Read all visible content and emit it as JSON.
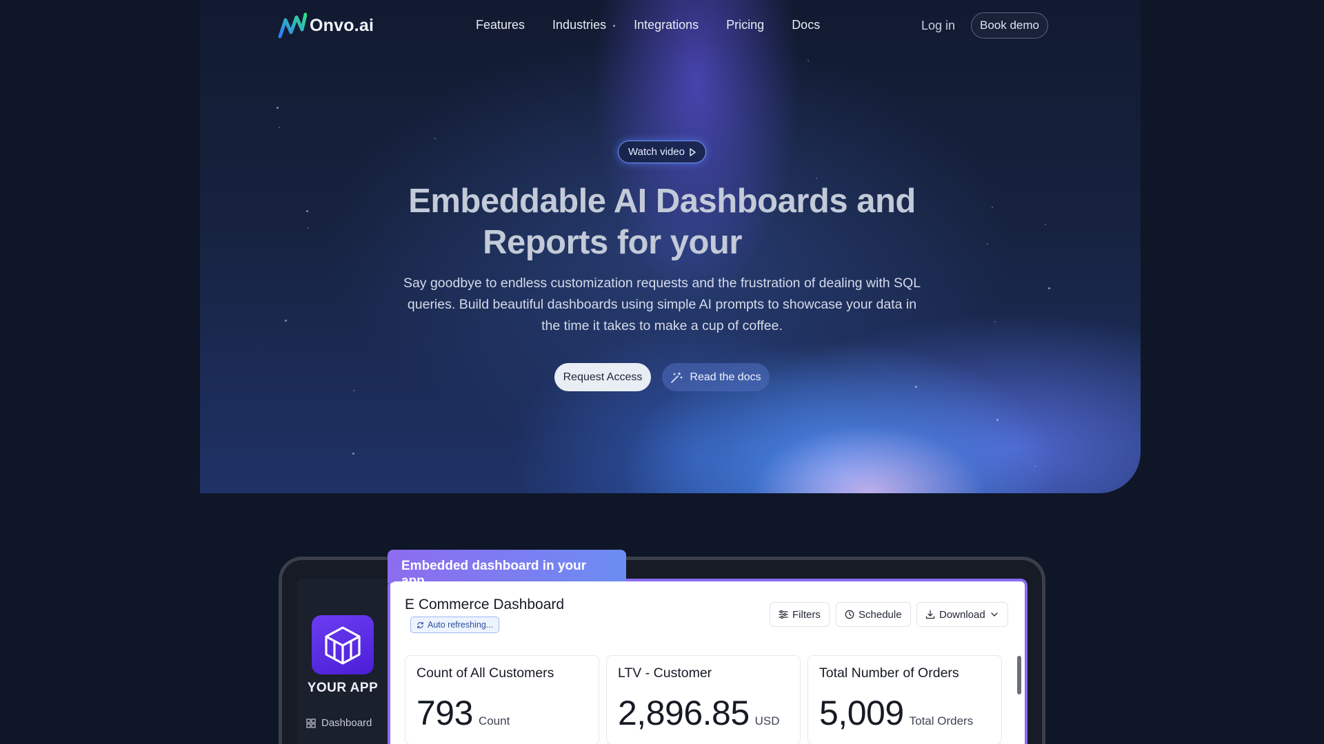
{
  "nav": {
    "brand": "Onvo.ai",
    "links": [
      "Features",
      "Industries",
      "Integrations",
      "Pricing",
      "Docs"
    ],
    "login": "Log in",
    "book_demo": "Book demo"
  },
  "hero": {
    "watch_video": "Watch video",
    "title_line1": "Embeddable AI Dashboards and",
    "title_line2": "Reports for your",
    "subtitle": "Say goodbye to endless customization requests and the frustration of dealing with SQL queries. Build beautiful dashboards using simple AI prompts to showcase your data in the time it takes to make a cup of coffee.",
    "request_access": "Request Access",
    "read_docs": "Read the docs"
  },
  "demo": {
    "tab_label": "Embedded dashboard in your app",
    "app_name": "YOUR APP",
    "sidebar_item": "Dashboard",
    "dashboard_title": "E Commerce Dashboard",
    "auto_refresh": "Auto refreshing...",
    "toolbar": {
      "filters": "Filters",
      "schedule": "Schedule",
      "download": "Download"
    },
    "kpis": [
      {
        "title": "Count of All Customers",
        "value": "793",
        "unit": "Count"
      },
      {
        "title": "LTV - Customer",
        "value": "2,896.85",
        "unit": "USD"
      },
      {
        "title": "Total Number of Orders",
        "value": "5,009",
        "unit": "Total Orders"
      }
    ]
  },
  "colors": {
    "background": "#0f1628",
    "accent_purple": "#8a6cf0",
    "accent_blue": "#6f9bff"
  },
  "icons": [
    "onvo-logo-icon",
    "play-icon",
    "magic-wand-icon",
    "refresh-icon",
    "filters-icon",
    "clock-icon",
    "download-icon",
    "chevron-down-icon",
    "grid-icon",
    "app-logo-icon"
  ]
}
